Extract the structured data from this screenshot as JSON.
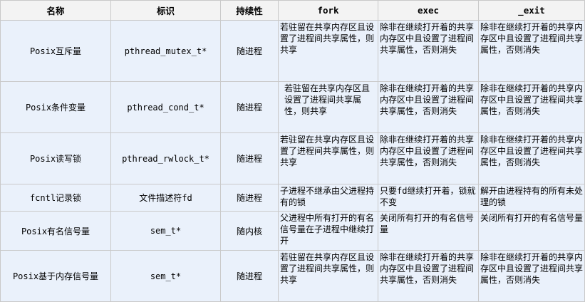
{
  "headers": [
    "名称",
    "标识",
    "持续性",
    "fork",
    "exec",
    "_exit"
  ],
  "rows": [
    {
      "name": "Posix互斥量",
      "id": "pthread_mutex_t*",
      "persistence": "随进程",
      "fork": "若驻留在共享内存区且设置了进程间共享属性，则共享",
      "exec": "除非在继续打开着的共享内存区中且设置了进程间共享属性，否则消失",
      "exit": "除非在继续打开着的共享内存区中且设置了进程间共享属性，否则消失"
    },
    {
      "name": "Posix条件变量",
      "id": "pthread_cond_t*",
      "persistence": "随进程",
      "fork": "若驻留在共享内存区且设置了进程间共享属性，则共享",
      "exec": "除非在继续打开着的共享内存区中且设置了进程间共享属性，否则消失",
      "exit": "除非在继续打开着的共享内存区中且设置了进程间共享属性，否则消失"
    },
    {
      "name": "Posix读写锁",
      "id": "pthread_rwlock_t*",
      "persistence": "随进程",
      "fork": "若驻留在共享内存区且设置了进程间共享属性，则共享",
      "exec": "除非在继续打开着的共享内存区中且设置了进程间共享属性，否则消失",
      "exit": "除非在继续打开着的共享内存区中且设置了进程间共享属性，否则消失"
    },
    {
      "name": "fcntl记录锁",
      "id": "文件描述符fd",
      "persistence": "随进程",
      "fork": "子进程不继承由父进程持有的锁",
      "exec": "只要fd继续打开着，锁就不变",
      "exit": "解开由进程持有的所有未处理的锁"
    },
    {
      "name": "Posix有名信号量",
      "id": "sem_t*",
      "persistence": "随内核",
      "fork": "父进程中所有打开的有名信号量在子进程中继续打开",
      "exec": "关闭所有打开的有名信号量",
      "exit": "关闭所有打开的有名信号量"
    },
    {
      "name": "Posix基于内存信号量",
      "id": "sem_t*",
      "persistence": "随进程",
      "fork": "若驻留在共享内存区且设置了进程间共享属性，则共享",
      "exec": "除非在继续打开着的共享内存区中且设置了进程间共享属性，否则消失",
      "exit": "除非在继续打开着的共享内存区中且设置了进程间共享属性，否则消失"
    }
  ]
}
